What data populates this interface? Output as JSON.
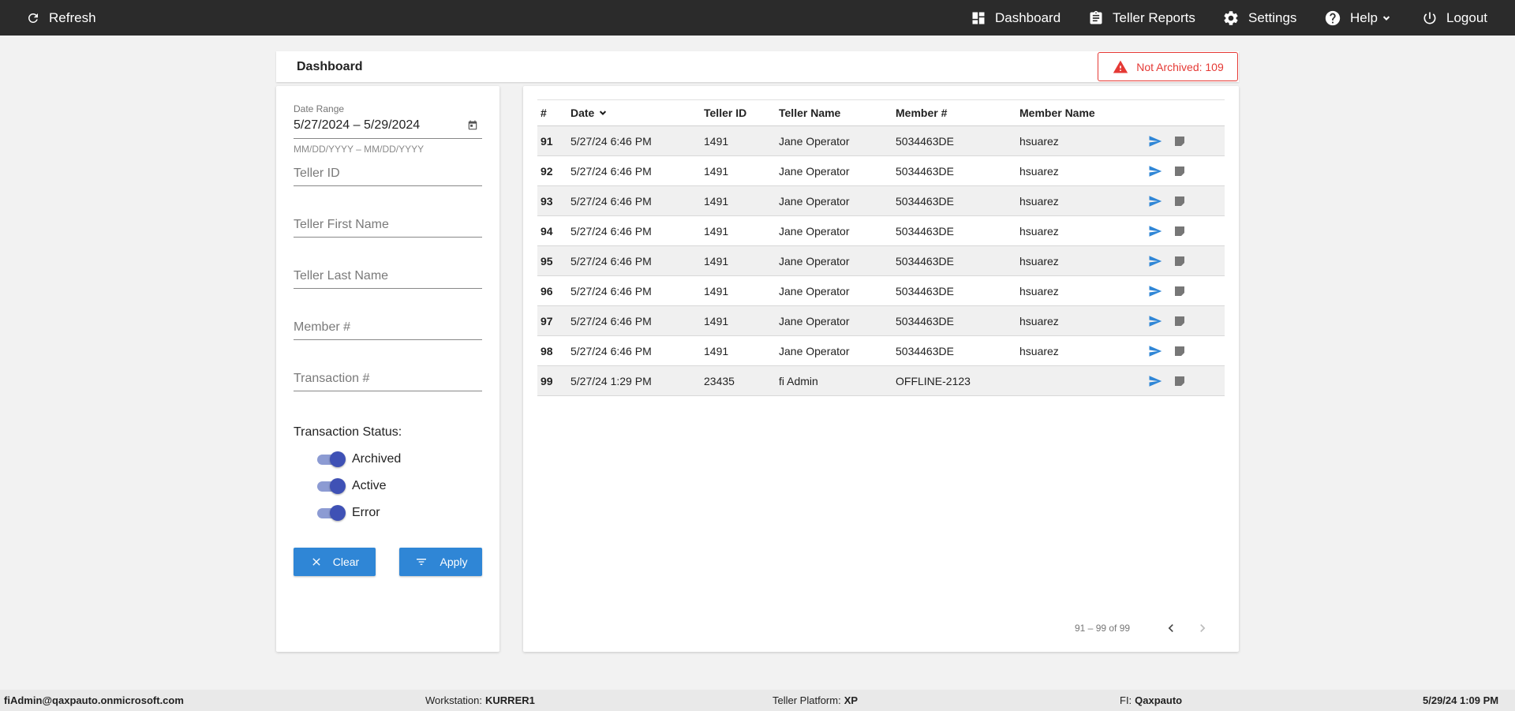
{
  "topbar": {
    "refresh": "Refresh",
    "dashboard": "Dashboard",
    "teller_reports": "Teller Reports",
    "settings": "Settings",
    "help": "Help",
    "logout": "Logout",
    "icons": [
      "refresh-icon",
      "dashboard-icon",
      "clipboard-icon",
      "gear-icon",
      "help-icon",
      "chevron-down-icon",
      "power-icon"
    ]
  },
  "header": {
    "title": "Dashboard",
    "not_archived_label": "Not Archived: 109",
    "alert_color": "#e53935"
  },
  "filters": {
    "date_range_label": "Date Range",
    "date_range_value": "5/27/2024 – 5/29/2024",
    "date_hint": "MM/DD/YYYY – MM/DD/YYYY",
    "teller_id_placeholder": "Teller ID",
    "teller_first_name_placeholder": "Teller First Name",
    "teller_last_name_placeholder": "Teller Last Name",
    "member_placeholder": "Member #",
    "transaction_placeholder": "Transaction #",
    "status_label": "Transaction Status:",
    "statuses": [
      {
        "label": "Archived",
        "on": true
      },
      {
        "label": "Active",
        "on": true
      },
      {
        "label": "Error",
        "on": true
      }
    ],
    "clear_label": "Clear",
    "apply_label": "Apply",
    "button_color": "#2f86d6"
  },
  "table": {
    "headers": [
      "#",
      "Date",
      "Teller ID",
      "Teller Name",
      "Member #",
      "Member Name"
    ],
    "rows": [
      {
        "num": "91",
        "date": "5/27/24 6:46 PM",
        "teller_id": "1491",
        "teller_name": "Jane Operator",
        "member": "5034463DE",
        "member_name": "hsuarez"
      },
      {
        "num": "92",
        "date": "5/27/24 6:46 PM",
        "teller_id": "1491",
        "teller_name": "Jane Operator",
        "member": "5034463DE",
        "member_name": "hsuarez"
      },
      {
        "num": "93",
        "date": "5/27/24 6:46 PM",
        "teller_id": "1491",
        "teller_name": "Jane Operator",
        "member": "5034463DE",
        "member_name": "hsuarez"
      },
      {
        "num": "94",
        "date": "5/27/24 6:46 PM",
        "teller_id": "1491",
        "teller_name": "Jane Operator",
        "member": "5034463DE",
        "member_name": "hsuarez"
      },
      {
        "num": "95",
        "date": "5/27/24 6:46 PM",
        "teller_id": "1491",
        "teller_name": "Jane Operator",
        "member": "5034463DE",
        "member_name": "hsuarez"
      },
      {
        "num": "96",
        "date": "5/27/24 6:46 PM",
        "teller_id": "1491",
        "teller_name": "Jane Operator",
        "member": "5034463DE",
        "member_name": "hsuarez"
      },
      {
        "num": "97",
        "date": "5/27/24 6:46 PM",
        "teller_id": "1491",
        "teller_name": "Jane Operator",
        "member": "5034463DE",
        "member_name": "hsuarez"
      },
      {
        "num": "98",
        "date": "5/27/24 6:46 PM",
        "teller_id": "1491",
        "teller_name": "Jane Operator",
        "member": "5034463DE",
        "member_name": "hsuarez"
      },
      {
        "num": "99",
        "date": "5/27/24 1:29 PM",
        "teller_id": "23435",
        "teller_name": "fi Admin",
        "member": "OFFLINE-2123",
        "member_name": ""
      }
    ],
    "row_icons": [
      "send-icon",
      "note-icon"
    ],
    "pagination": "91 – 99 of 99"
  },
  "footer": {
    "user": "fiAdmin@qaxpauto.onmicrosoft.com",
    "workstation_label": "Workstation:",
    "workstation": "KURRER1",
    "platform_label": "Teller Platform:",
    "platform": "XP",
    "fi_label": "FI:",
    "fi": "Qaxpauto",
    "datetime": "5/29/24 1:09 PM"
  }
}
